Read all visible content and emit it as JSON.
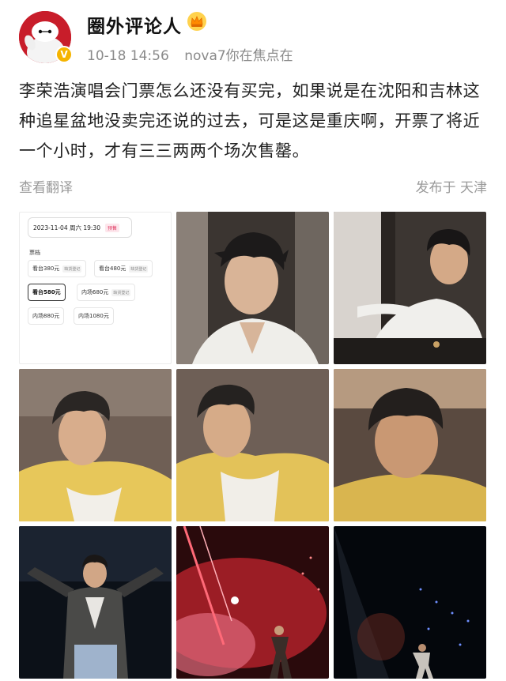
{
  "user": {
    "name": "圈外评论人",
    "badge_letter": "V",
    "time": "10-18 14:56",
    "device": "nova7你在焦点在"
  },
  "post": {
    "text": "李荣浩演唱会门票怎么还没有买完，如果说是在沈阳和吉林这种追星盆地没卖完还说的过去，可是这是重庆啊，开票了将近一个小时，才有三三两两个场次售罄。",
    "translate": "查看翻译",
    "location": "发布于 天津"
  },
  "ticket": {
    "date": "2023-11-04 周六 19:30",
    "date_tag": "预售",
    "price_label": "票档",
    "options": [
      {
        "label": "看台380元",
        "sub": "缺货登记"
      },
      {
        "label": "看台480元",
        "sub": "缺货登记"
      },
      {
        "label": "看台580元",
        "sub": ""
      },
      {
        "label": "内场680元",
        "sub": "缺货登记"
      },
      {
        "label": "内场880元",
        "sub": ""
      },
      {
        "label": "内场1080元",
        "sub": ""
      }
    ]
  },
  "photos": [
    "ticket-screenshot",
    "selfie-white-shirt-1",
    "selfie-white-shirt-2",
    "selfie-yellow-shirt-1",
    "selfie-yellow-shirt-2",
    "selfie-yellow-shirt-3",
    "concert-stage-1",
    "concert-stage-red",
    "concert-stage-dark"
  ],
  "colors": {
    "accent_gold": "#f5b400",
    "meta_gray": "#8a8a8a",
    "ticket_tag": "#e03a62"
  }
}
